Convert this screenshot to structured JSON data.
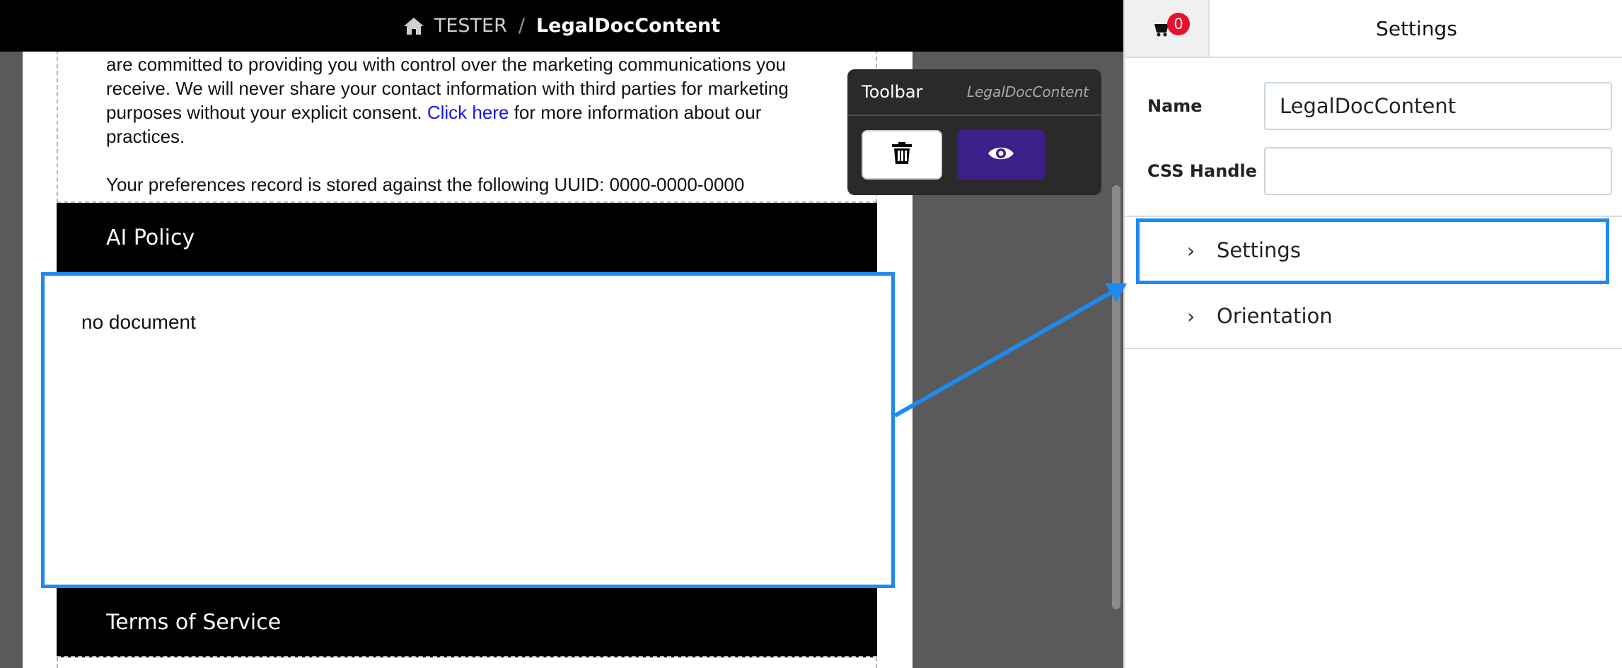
{
  "topbar": {
    "home_icon": "home-icon",
    "root": "TESTER",
    "separator": "/",
    "current": "LegalDocContent"
  },
  "document": {
    "intro_line_1": "are committed to providing you with control over the marketing communications you receive. We will never share your contact information with third parties for marketing purposes without your explicit consent.",
    "intro_link": "Click here",
    "intro_line_1_end": "for more information about our practices.",
    "uuid_line": "Your preferences record is stored against the following UUID: 0000-0000-0000",
    "ai_policy_header": "AI Policy",
    "selected_doc_text": "no document",
    "tos_header": "Terms of Service"
  },
  "toolbar": {
    "title": "Toolbar",
    "subtitle": "LegalDocContent",
    "delete_icon": "trash-icon",
    "preview_icon": "eye-icon"
  },
  "panel": {
    "cart_badge": "0",
    "title": "Settings",
    "name_label": "Name",
    "name_value": "LegalDocContent",
    "css_label": "CSS Handle",
    "css_value": "",
    "accordion": [
      {
        "label": "Settings"
      },
      {
        "label": "Orientation"
      }
    ]
  },
  "colors": {
    "highlight": "#1e8af0",
    "preview_button": "#3d1f8a",
    "badge": "#e8102a"
  }
}
